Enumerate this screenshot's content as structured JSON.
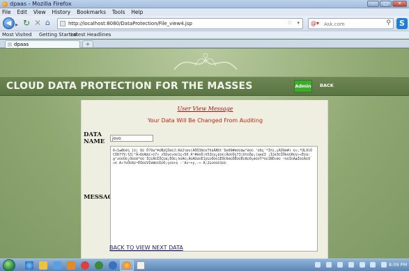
{
  "window": {
    "title": "dpaas - Mozilla Firefox"
  },
  "menu": [
    "File",
    "Edit",
    "View",
    "History",
    "Bookmarks",
    "Tools",
    "Help"
  ],
  "nav": {
    "url": "http://localhost:8080/DataProtection/File_view4.jsp",
    "search_placeholder": "Ask.com"
  },
  "bookmarks": {
    "most_visited": "Most Visited",
    "getting_started": "Getting Started",
    "latest_headlines": "Latest Headlines"
  },
  "tab": {
    "label": "dpaas",
    "new_tab": "+"
  },
  "page": {
    "site_title": "CLOUD DATA PROTECTION FOR THE MASSES",
    "admin_label": "Admin",
    "back_label": "BACK",
    "heading": "User View Message",
    "notice": "Your Data Will Be Changed From Auditing",
    "data_name_label": "DATA NAME",
    "data_name_value": "jovo",
    "message_label": "MESSAGE",
    "message_text": "6«1±Ø©ê¼ ]©¦ ß© Ö?9a²Þ©ÑÿÇÕè©J:Rè2\\ms(ÃÓÕ3ß©sThùÂÆXt`De09#ê©©ãw²ê©© '©ßç`*Ìñï,çÃÕ9é#) ©¤,*ÚL9lÓCÒ6779:§3¦°Ã»ß©Wãï»©7¤  z5Dy©¤ö©1ç»50 A¹#ê©Õ|h5Z©y¿£©©|Ã©©Õç73|Ut©Öp¡(qe£3 ¡Ì2è3©ÎÖk©©R©ÿ»«È©ä:_g¹z©©Û©¡Õ©©ê*©©¨ÎÇ©Ä©ÎÖÇ©ä¡ÈÒ©¡hóÁ©¡Ä©ÁÙü©È1ÿL©Õ©©1ÈÓ©9é©ÔÊ©©É©ß©Óçé©©Ý*©©1ÑÖ¤ê© ~©©Î©ÁæÎ©©Ä©9¤© A»?©Ö©ß©¬ÉÕ©©VIèW©©Ì©Ó;ç©©+¢ -'Av~+y,-« Ã¦2L©©©©1©© "
  },
  "links": {
    "back_to_view": "BACK TO VIEW NEXT DATA"
  },
  "taskbar": {
    "clock": "8:09 PM"
  }
}
